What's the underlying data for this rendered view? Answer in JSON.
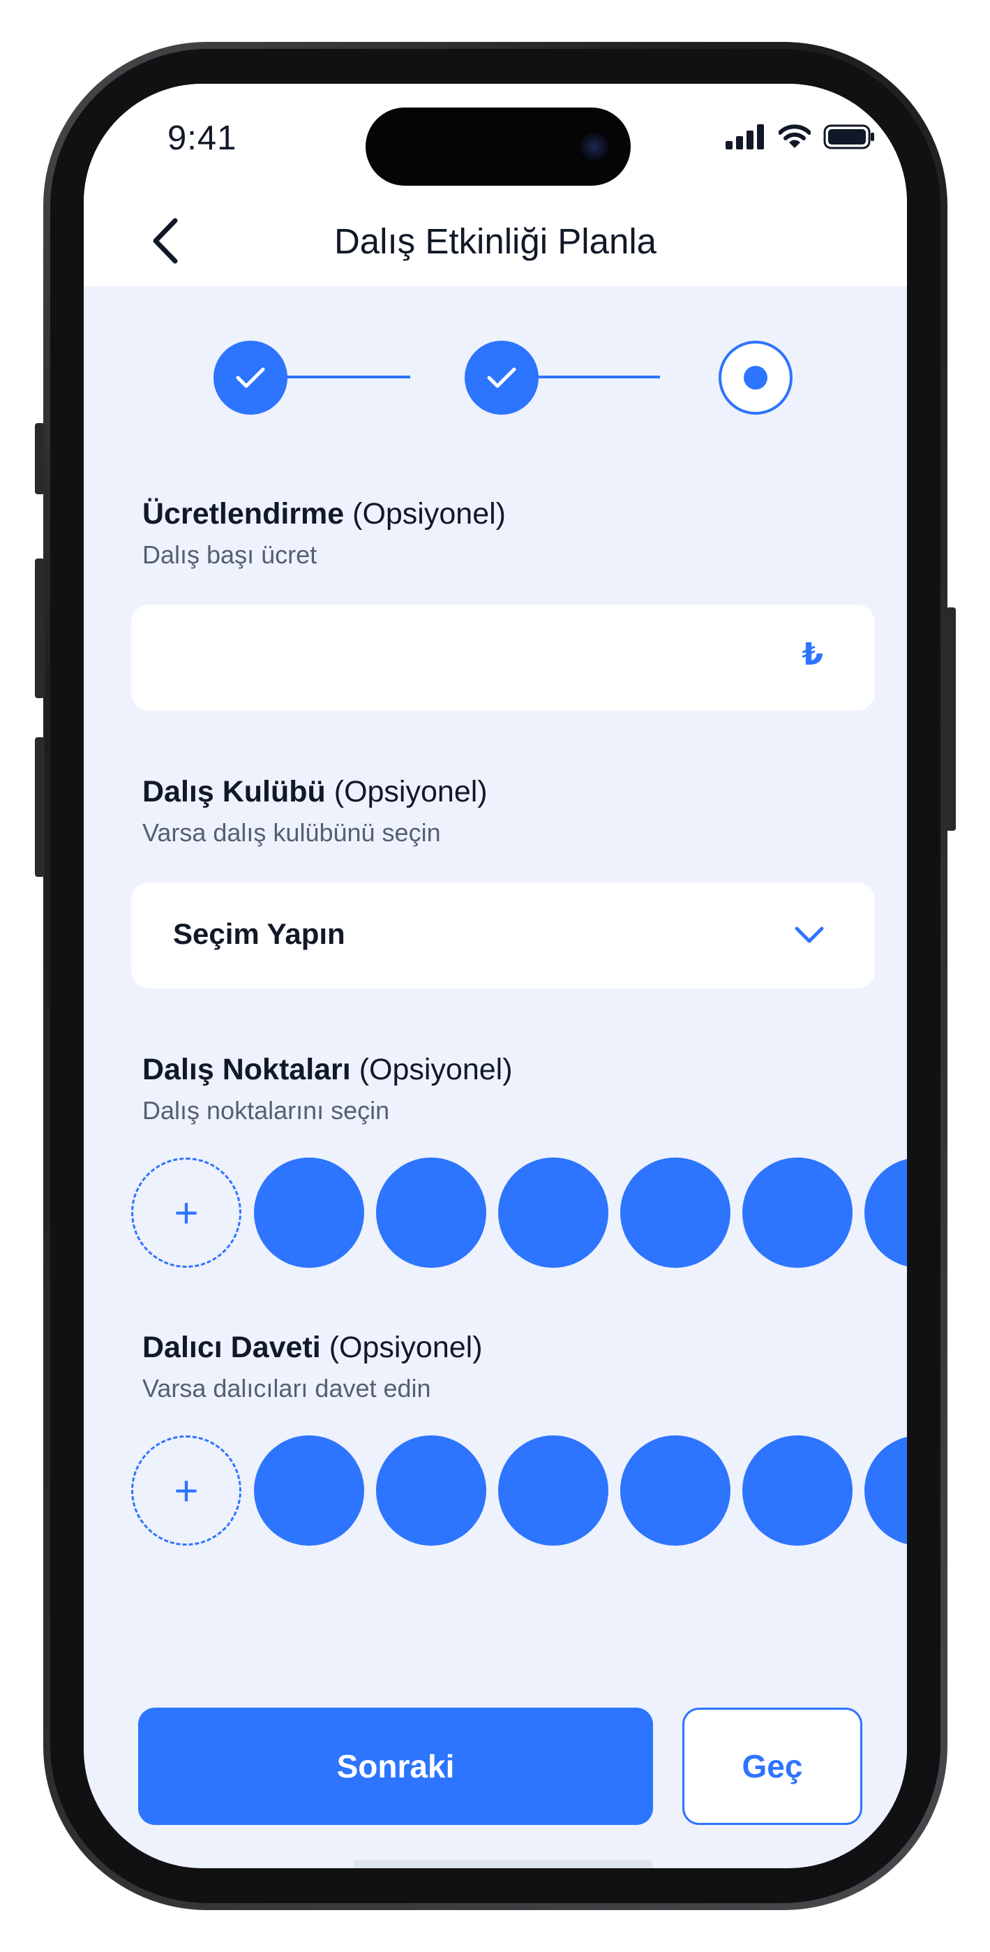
{
  "status_bar": {
    "time": "9:41"
  },
  "nav": {
    "title": "Dalış Etkinliği Planla",
    "back_icon": "chevron-left-icon"
  },
  "stepper": {
    "total_steps": 3,
    "current_step": 3
  },
  "pricing": {
    "title_bold": "Ücretlendirme",
    "title_suffix": "(Opsiyonel)",
    "subtitle": "Dalış başı ücret",
    "input_value": "",
    "currency_symbol": "₺"
  },
  "club": {
    "title_bold": "Dalış Kulübü",
    "title_suffix": "(Opsiyonel)",
    "subtitle": "Varsa dalış kulübünü seçin",
    "select_value": "Seçim Yapın"
  },
  "dive_spots": {
    "title_bold": "Dalış Noktaları",
    "title_suffix": "(Opsiyonel)",
    "subtitle": "Dalış noktalarını seçin",
    "add_label": "+"
  },
  "invite": {
    "title_bold": "Dalıcı Daveti",
    "title_suffix": "(Opsiyonel)",
    "subtitle": "Varsa dalıcıları davet edin",
    "add_label": "+"
  },
  "actions": {
    "next_label": "Sonraki",
    "skip_label": "Geç"
  },
  "colors": {
    "accent": "#2d74ff",
    "background": "#eef2fd",
    "text": "#111827",
    "muted": "#55606f"
  }
}
